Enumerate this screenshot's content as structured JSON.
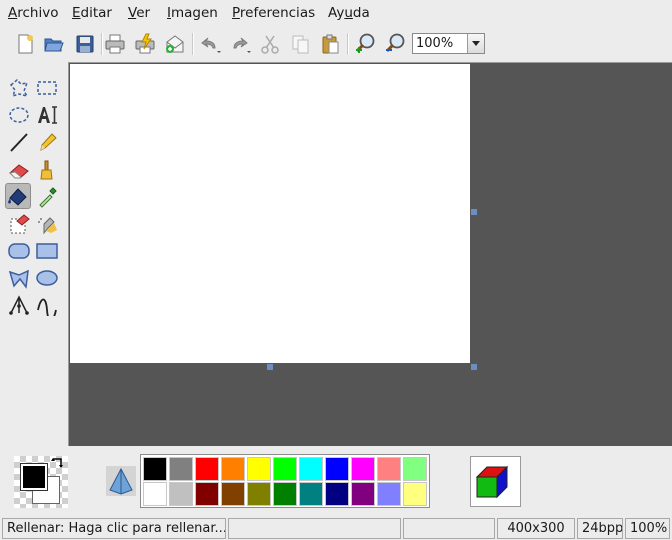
{
  "menubar": {
    "items": [
      {
        "label": "Archivo",
        "mnemonic": "A",
        "rest": "rchivo"
      },
      {
        "label": "Editar",
        "mnemonic": "E",
        "rest": "ditar"
      },
      {
        "label": "Ver",
        "mnemonic": "V",
        "rest": "er"
      },
      {
        "label": "Imagen",
        "mnemonic": "I",
        "rest": "magen"
      },
      {
        "label": "Preferencias",
        "mnemonic": "P",
        "rest": "referencias"
      },
      {
        "label": "Ayuda",
        "pre": "Ay",
        "mnemonic": "u",
        "rest": "da"
      }
    ]
  },
  "toolbar": {
    "buttons": [
      "new-icon",
      "open-icon",
      "save-icon",
      "print-icon",
      "print-preview-icon",
      "email-icon",
      "undo-icon",
      "redo-icon",
      "cut-icon",
      "copy-icon",
      "paste-icon",
      "zoom-in-icon",
      "zoom-out-icon"
    ],
    "zoom_value": "100%"
  },
  "tools": [
    "free-select-icon",
    "rect-select-icon",
    "ellipse-select-icon",
    "text-icon",
    "line-icon",
    "pencil-icon",
    "eraser-icon",
    "brush-icon",
    "fill-icon",
    "color-picker-icon",
    "color-eraser-icon",
    "airbrush-icon",
    "rounded-rect-icon",
    "rectangle-icon",
    "polygon-icon",
    "ellipse-icon",
    "bezier-icon",
    "curve-icon"
  ],
  "active_tool": "fill-icon",
  "colors": {
    "foreground": "#000000",
    "background": "#ffffff",
    "palette_top": [
      "#000000",
      "#808080",
      "#ff0000",
      "#ff8000",
      "#ffff00",
      "#00ff00",
      "#00ffff",
      "#0000ff",
      "#ff00ff",
      "#ff8080",
      "#80ff80"
    ],
    "palette_bottom": [
      "#ffffff",
      "#c0c0c0",
      "#800000",
      "#804000",
      "#808000",
      "#008000",
      "#008080",
      "#000080",
      "#800080",
      "#8080ff",
      "#ffff80"
    ],
    "canvas_bg": "#555555"
  },
  "statusbar": {
    "message": "Rellenar: Haga clic para rellenar...",
    "size": "400x300",
    "depth": "24bpp",
    "zoom": "100%"
  }
}
